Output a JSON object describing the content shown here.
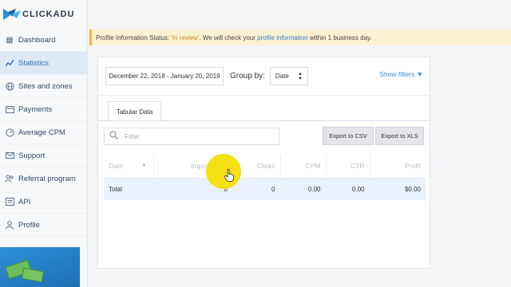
{
  "brand": {
    "name": "CLICKADU",
    "logo_icon": "clickadu-logo"
  },
  "sidebar": {
    "items": [
      {
        "label": "Dashboard",
        "icon": "dashboard-icon",
        "glyph": "▦",
        "active": false
      },
      {
        "label": "Statistics",
        "icon": "chart-icon",
        "glyph": "📈",
        "active": true
      },
      {
        "label": "Sites and zones",
        "icon": "globe-icon",
        "glyph": "🌐",
        "active": false
      },
      {
        "label": "Payments",
        "icon": "card-icon",
        "glyph": "▭",
        "active": false
      },
      {
        "label": "Average CPM",
        "icon": "gauge-icon",
        "glyph": "◔",
        "active": false
      },
      {
        "label": "Support",
        "icon": "mail-icon",
        "glyph": "✉",
        "active": false
      },
      {
        "label": "Referral program",
        "icon": "people-icon",
        "glyph": "👥",
        "active": false
      },
      {
        "label": "API",
        "icon": "api-icon",
        "glyph": "▤",
        "active": false
      },
      {
        "label": "Profile",
        "icon": "user-icon",
        "glyph": "👤",
        "active": false
      }
    ]
  },
  "notice": {
    "prefix": "Profile Information Status: ",
    "status": "'In review'",
    "middle": ". We will check your ",
    "link": "profile information",
    "suffix": " within 1 business day."
  },
  "filters": {
    "date_range": "December 22, 2018 - January 20, 2019",
    "group_by_label": "Group by:",
    "group_by_value": "Date",
    "show_filters": "Show filters ▼"
  },
  "tabs": {
    "active": "Tabular Data"
  },
  "table_tools": {
    "search_placeholder": "Filter",
    "export_csv": "Export to CSV",
    "export_xls": "Export to XLS"
  },
  "table": {
    "headers": [
      "Date",
      "Impressions",
      "Clicks",
      "CPM",
      "CTR",
      "Profit"
    ],
    "total_row": [
      "Total",
      "0",
      "0",
      "0.00",
      "0.00",
      "$0.00"
    ]
  },
  "colors": {
    "accent": "#2a6fb3",
    "notice_bg": "#fdf1d3",
    "notice_border": "#f0b73a",
    "highlight": "#f5de00"
  }
}
